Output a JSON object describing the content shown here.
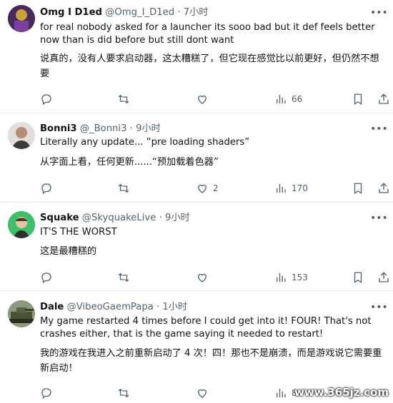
{
  "tweets": [
    {
      "name": "Omg I D1ed",
      "handle": "@Omg_I_D1ed",
      "dot": "·",
      "time": "7小时",
      "text_en": "for real nobody asked for a launcher its sooo bad but it def feels better now than is did before but still dont want",
      "text_zh": "说真的，没有人要求启动器，这太糟糕了，但它现在感觉比以前更好，但仍然不想要",
      "likes": "",
      "views": "66"
    },
    {
      "name": "Bonni3",
      "handle": "@_Bonni3",
      "dot": "·",
      "time": "9小时",
      "text_en": "Literally any update... “pre loading shaders”",
      "text_zh": "从字面上看，任何更新......“预加载着色器”",
      "likes": "2",
      "views": "170"
    },
    {
      "name": "Squake",
      "handle": "@SkyquakeLive",
      "dot": "·",
      "time": "9小时",
      "text_en": "IT'S THE WORST",
      "text_zh": "这是最糟糕的",
      "likes": "",
      "views": "153"
    },
    {
      "name": "Dale",
      "handle": "@VibeoGaemPapa",
      "dot": "·",
      "time": "1小时",
      "text_en": "My game restarted 4 times before I could get into it! FOUR! That's not crashes either, that is the game saying it needed to restart!",
      "text_zh": "我的游戏在我进入之前重新启动了 4 次！四！那也不是崩溃，而是游戏说它需要重新启动！",
      "likes": "",
      "views": "8"
    }
  ],
  "icons": [
    "reply-icon",
    "retweet-icon",
    "like-icon",
    "views-icon",
    "bookmark-icon",
    "share-icon",
    "more-icon"
  ],
  "watermark": "www.365jz.com",
  "colors": {
    "text": "#0f1419",
    "secondary": "#536471",
    "divider": "#e6e9ec"
  }
}
